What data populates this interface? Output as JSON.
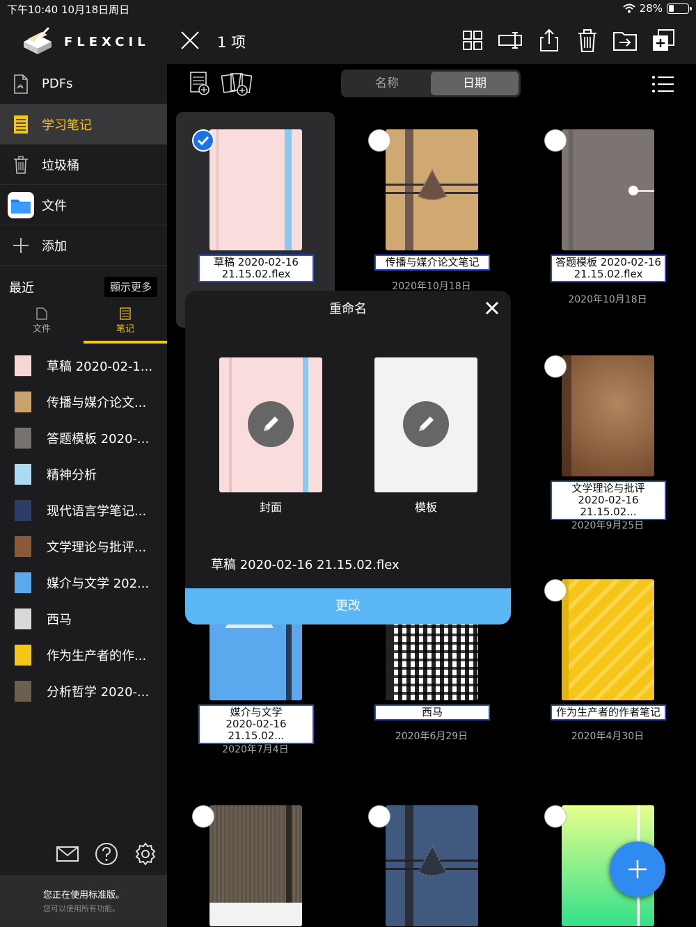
{
  "status": {
    "time": "下午10:40 10月18日周日",
    "battery": "28%",
    "battery_level": 0.28
  },
  "app": {
    "name": "FLEXCIL"
  },
  "sidebar": {
    "items": [
      {
        "label": "PDFs",
        "icon": "pdf-icon"
      },
      {
        "label": "学习笔记",
        "icon": "notebook-icon"
      },
      {
        "label": "垃圾桶",
        "icon": "trash-icon"
      },
      {
        "label": "文件",
        "icon": "files-app-icon"
      },
      {
        "label": "添加",
        "icon": "plus-icon"
      }
    ],
    "recent_title": "最近",
    "show_more": "顯示更多",
    "recent_tabs": [
      {
        "label": "文件",
        "icon": "pdf-icon"
      },
      {
        "label": "笔记",
        "icon": "notebook-icon"
      }
    ],
    "recent": [
      {
        "label": "草稿 2020-02-1...",
        "color": "#f6d6d6"
      },
      {
        "label": "传播与媒介论文...",
        "color": "#caa36c"
      },
      {
        "label": "答题模板 2020-...",
        "color": "#777170"
      },
      {
        "label": "精神分析",
        "color": "#a9dcf2"
      },
      {
        "label": "现代语言学笔记...",
        "color": "#2b3f66"
      },
      {
        "label": "文学理论与批评...",
        "color": "#8a5a38"
      },
      {
        "label": "媒介与文学 202...",
        "color": "#5aa9ef"
      },
      {
        "label": "西马",
        "color": "#d9d9d9"
      },
      {
        "label": "作为生产者的作...",
        "color": "#f5c518"
      },
      {
        "label": "分析哲学 2020-...",
        "color": "#6b5f52"
      }
    ],
    "footer": {
      "line1": "您正在使用标准版。",
      "line2": "您可以使用所有功能。"
    }
  },
  "toolbar": {
    "count": "1 项"
  },
  "sort": {
    "name": "名称",
    "date": "日期",
    "active": "日期"
  },
  "notebooks": [
    {
      "name": "草稿 2020-02-16\n21.15.02.flex",
      "date": "",
      "selected": true
    },
    {
      "name": "传播与媒介论文笔记",
      "date": "2020年10月18日",
      "selected": false
    },
    {
      "name": "答题模板 2020-02-16\n21.15.02.flex",
      "date": "2020年10月18日",
      "selected": false
    },
    {
      "name": "文学理论与批评\n2020-02-16 21.15.02...",
      "date": "2020年9月25日",
      "selected": false
    },
    {
      "name": "媒介与文学\n2020-02-16 21.15.02...",
      "date": "2020年7月4日",
      "selected": false
    },
    {
      "name": "西马",
      "date": "2020年6月29日",
      "selected": false
    },
    {
      "name": "作为生产者的作者笔记",
      "date": "2020年4月30日",
      "selected": false
    }
  ],
  "modal": {
    "title": "重命名",
    "cover_label": "封面",
    "template_label": "模板",
    "filename": "草稿 2020-02-16 21.15.02.flex",
    "confirm": "更改"
  }
}
